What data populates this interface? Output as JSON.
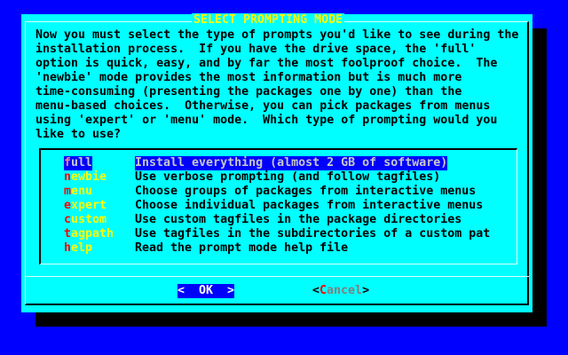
{
  "title": "SELECT PROMPTING MODE",
  "message_lines": [
    "Now you must select the type of prompts you'd like to see during the",
    "installation process.  If you have the drive space, the 'full'",
    "option is quick, easy, and by far the most foolproof choice.  The",
    "'newbie' mode provides the most information but is much more",
    "time-consuming (presenting the packages one by one) than the",
    "menu-based choices.  Otherwise, you can pick packages from menus",
    "using 'expert' or 'menu' mode.  Which type of prompting would you",
    "like to use?"
  ],
  "items": [
    {
      "hotkey": "f",
      "rest": "ull",
      "description": "Install everything (almost 2 GB of software)",
      "selected": true
    },
    {
      "hotkey": "n",
      "rest": "ewbie",
      "description": "Use verbose prompting (and follow tagfiles)"
    },
    {
      "hotkey": "m",
      "rest": "enu",
      "description": "Choose groups of packages from interactive menus"
    },
    {
      "hotkey": "e",
      "rest": "xpert",
      "description": "Choose individual packages from interactive menus"
    },
    {
      "hotkey": "c",
      "rest": "ustom",
      "description": "Use custom tagfiles in the package directories"
    },
    {
      "hotkey": "t",
      "rest": "agpath",
      "description": "Use tagfiles in the subdirectories of a custom pat"
    },
    {
      "hotkey": "h",
      "rest": "elp",
      "description": "Read the prompt mode help file"
    }
  ],
  "buttons": {
    "ok": "<  OK  >",
    "cancel_open": "<",
    "cancel_hotkey": "C",
    "cancel_rest": "ancel",
    "cancel_close": ">"
  }
}
